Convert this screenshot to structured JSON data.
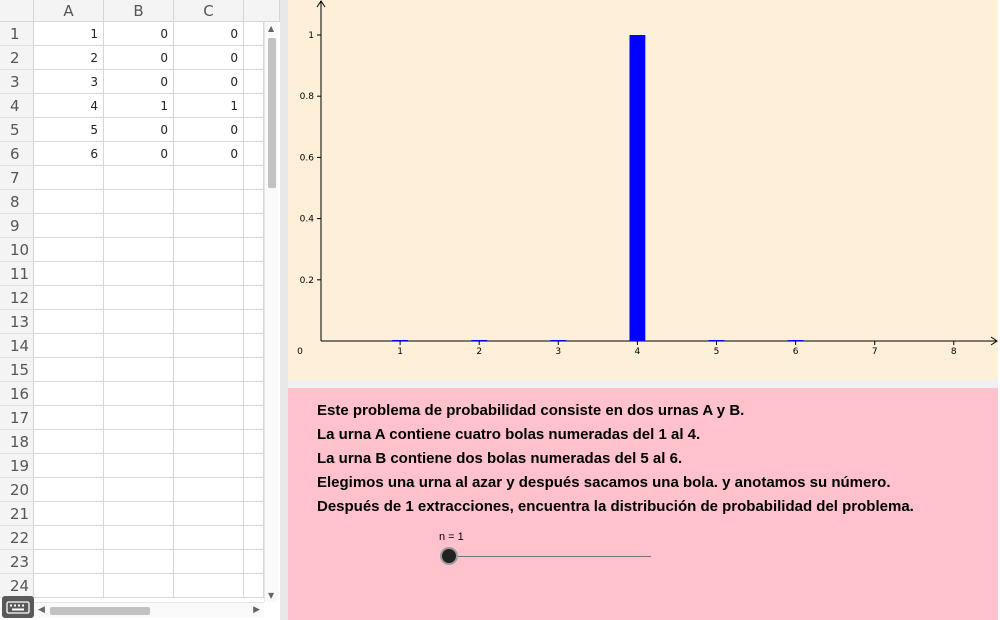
{
  "spreadsheet": {
    "columns": [
      "A",
      "B",
      "C"
    ],
    "rows": [
      {
        "num": "1",
        "cells": [
          "1",
          "0",
          "0"
        ]
      },
      {
        "num": "2",
        "cells": [
          "2",
          "0",
          "0"
        ]
      },
      {
        "num": "3",
        "cells": [
          "3",
          "0",
          "0"
        ]
      },
      {
        "num": "4",
        "cells": [
          "4",
          "1",
          "1"
        ]
      },
      {
        "num": "5",
        "cells": [
          "5",
          "0",
          "0"
        ]
      },
      {
        "num": "6",
        "cells": [
          "6",
          "0",
          "0"
        ]
      },
      {
        "num": "7",
        "cells": [
          "",
          "",
          ""
        ]
      },
      {
        "num": "8",
        "cells": [
          "",
          "",
          ""
        ]
      },
      {
        "num": "9",
        "cells": [
          "",
          "",
          ""
        ]
      },
      {
        "num": "10",
        "cells": [
          "",
          "",
          ""
        ]
      },
      {
        "num": "11",
        "cells": [
          "",
          "",
          ""
        ]
      },
      {
        "num": "12",
        "cells": [
          "",
          "",
          ""
        ]
      },
      {
        "num": "13",
        "cells": [
          "",
          "",
          ""
        ]
      },
      {
        "num": "14",
        "cells": [
          "",
          "",
          ""
        ]
      },
      {
        "num": "15",
        "cells": [
          "",
          "",
          ""
        ]
      },
      {
        "num": "16",
        "cells": [
          "",
          "",
          ""
        ]
      },
      {
        "num": "17",
        "cells": [
          "",
          "",
          ""
        ]
      },
      {
        "num": "18",
        "cells": [
          "",
          "",
          ""
        ]
      },
      {
        "num": "19",
        "cells": [
          "",
          "",
          ""
        ]
      },
      {
        "num": "20",
        "cells": [
          "",
          "",
          ""
        ]
      },
      {
        "num": "21",
        "cells": [
          "",
          "",
          ""
        ]
      },
      {
        "num": "22",
        "cells": [
          "",
          "",
          ""
        ]
      },
      {
        "num": "23",
        "cells": [
          "",
          "",
          ""
        ]
      },
      {
        "num": "24",
        "cells": [
          "",
          "",
          ""
        ]
      }
    ]
  },
  "chart_data": {
    "type": "bar",
    "x": [
      1,
      2,
      3,
      4,
      5,
      6
    ],
    "values": [
      0,
      0,
      0,
      1,
      0,
      0
    ],
    "xticks": [
      "0",
      "1",
      "2",
      "3",
      "4",
      "5",
      "6",
      "7",
      "8"
    ],
    "yticks": [
      "0.2",
      "0.4",
      "0.6",
      "0.8",
      "1"
    ],
    "xlim": [
      0,
      8.5
    ],
    "ylim": [
      0,
      1.1
    ],
    "grid": false,
    "bar_color": "#0000ff",
    "background": "#fdefd8"
  },
  "panel": {
    "background": "#ffc1cc",
    "lines": [
      "Este problema de probabilidad consiste en dos urnas A y B.",
      "La urna A contiene cuatro bolas numeradas del 1 al 4.",
      "La urna B contiene dos bolas numeradas del 5 al 6.",
      "Elegimos una urna al azar y después sacamos una bola. y anotamos su número.",
      "Después de 1 extracciones, encuentra la distribución de probabilidad del problema."
    ],
    "slider": {
      "label": "n = 1",
      "value": 1,
      "fraction": 0
    }
  },
  "icons": {
    "keyboard": "keyboard-icon"
  }
}
